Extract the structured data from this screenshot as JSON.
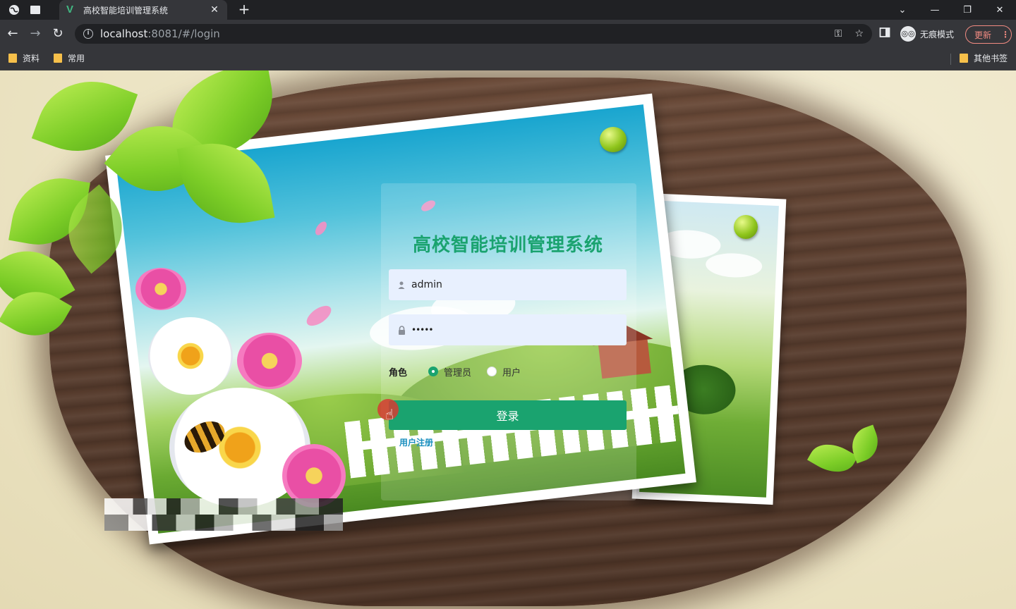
{
  "browser": {
    "tab_title": "高校智能培训管理系统",
    "url_host": "localhost",
    "url_path": ":8081/#/login",
    "incognito_label": "无痕模式",
    "update_label": "更新",
    "bookmarks": [
      "资料",
      "常用"
    ],
    "other_bookmarks": "其他书签"
  },
  "login": {
    "title": "高校智能培训管理系统",
    "username_value": "admin",
    "password_value": "•••••",
    "role_label": "角色",
    "roles": [
      {
        "label": "管理员",
        "checked": true
      },
      {
        "label": "用户",
        "checked": false
      }
    ],
    "login_button": "登录",
    "register_link": "用户注册"
  },
  "colors": {
    "accent": "#1aa36f",
    "field_bg": "#e8f0fe"
  },
  "icons": {
    "username": "user-icon",
    "password": "lock-icon"
  }
}
